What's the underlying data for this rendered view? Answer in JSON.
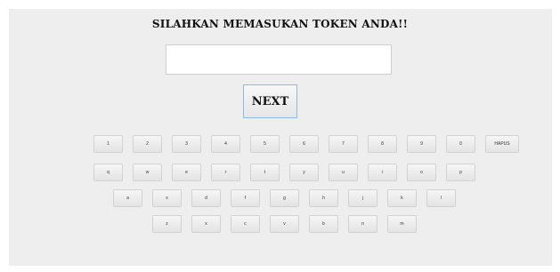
{
  "title": "SILAHKAN MEMASUKAN TOKEN ANDA!!",
  "token_input": {
    "value": "",
    "placeholder": ""
  },
  "next_label": "NEXT",
  "keyboard": {
    "row1": [
      "1",
      "2",
      "3",
      "4",
      "5",
      "6",
      "7",
      "8",
      "9",
      "0",
      "HAPUS"
    ],
    "row2": [
      "q",
      "w",
      "e",
      "r",
      "t",
      "y",
      "u",
      "i",
      "o",
      "p"
    ],
    "row3": [
      "a",
      "s",
      "d",
      "f",
      "g",
      "h",
      "j",
      "k",
      "l"
    ],
    "row4": [
      "z",
      "x",
      "c",
      "v",
      "b",
      "n",
      "m"
    ]
  }
}
